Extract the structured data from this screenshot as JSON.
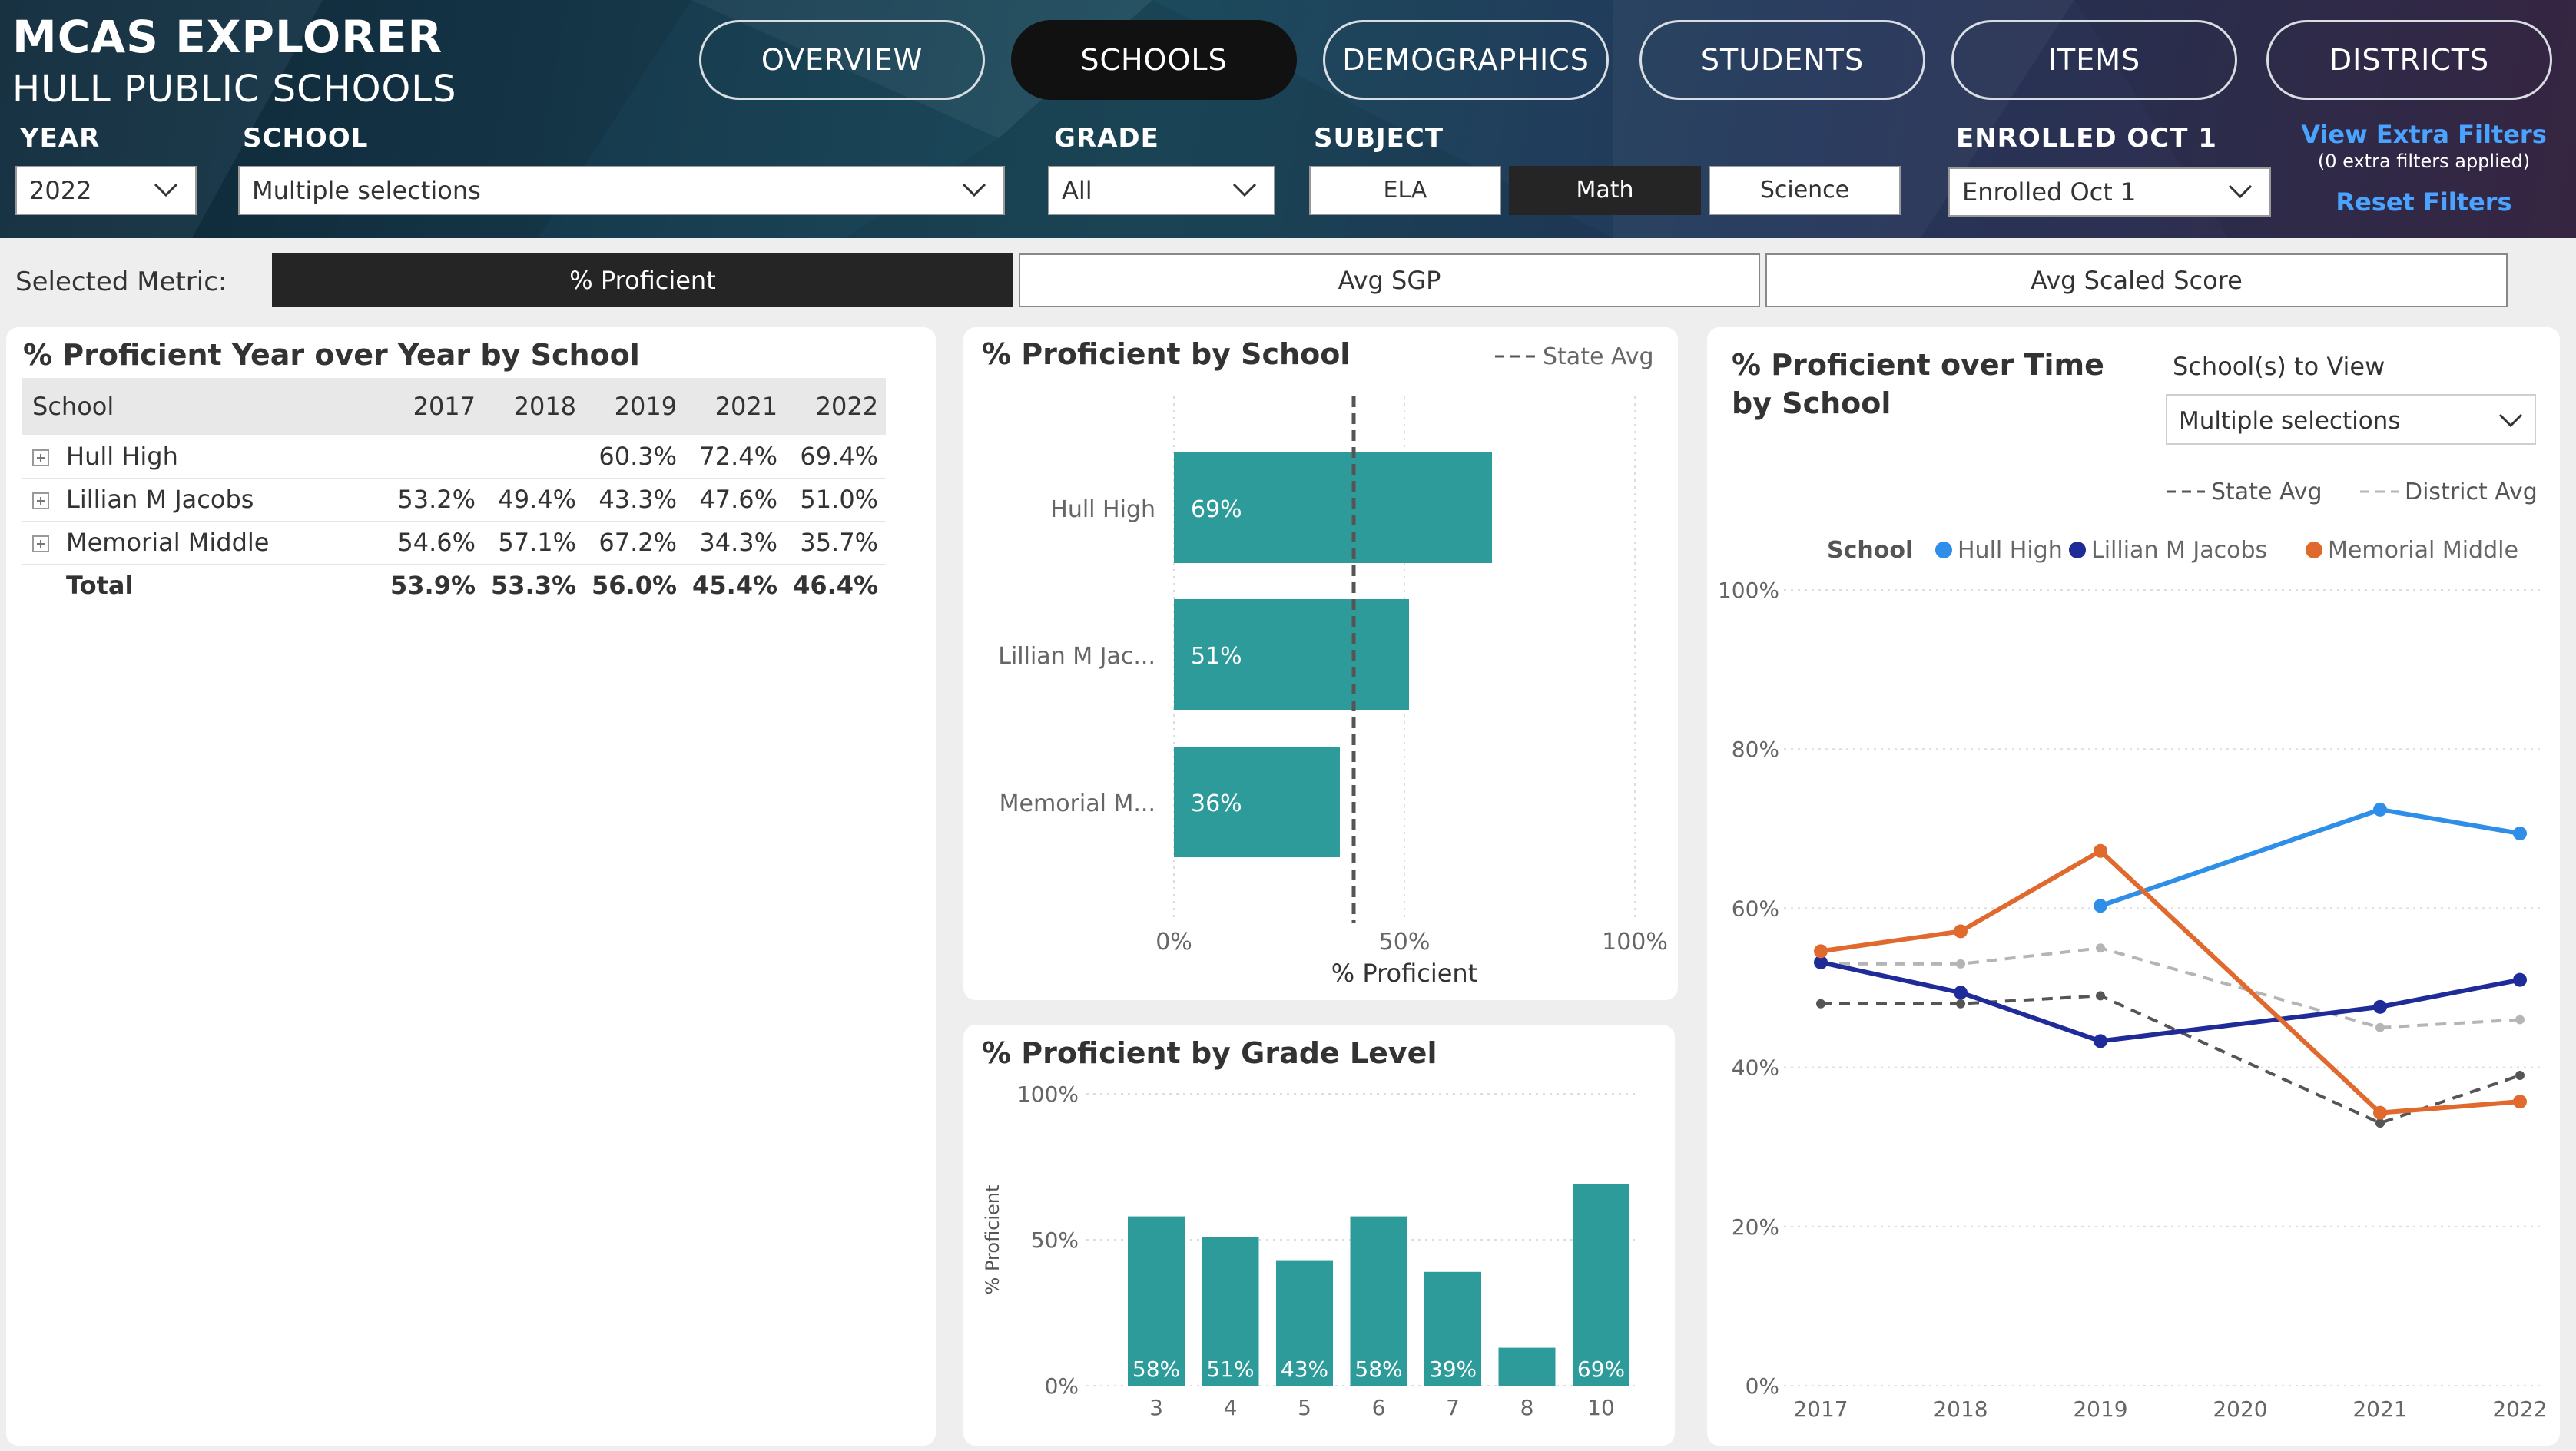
{
  "app": {
    "title": "MCAS EXPLORER",
    "subtitle": "HULL PUBLIC SCHOOLS"
  },
  "nav": [
    {
      "label": "OVERVIEW",
      "active": false
    },
    {
      "label": "SCHOOLS",
      "active": true
    },
    {
      "label": "DEMOGRAPHICS",
      "active": false
    },
    {
      "label": "STUDENTS",
      "active": false
    },
    {
      "label": "ITEMS",
      "active": false
    },
    {
      "label": "DISTRICTS",
      "active": false
    }
  ],
  "filters": {
    "year": {
      "label": "YEAR",
      "value": "2022"
    },
    "school": {
      "label": "SCHOOL",
      "value": "Multiple selections"
    },
    "grade": {
      "label": "GRADE",
      "value": "All"
    },
    "subject": {
      "label": "SUBJECT",
      "options": [
        "ELA",
        "Math",
        "Science"
      ],
      "selected": "Math"
    },
    "enrolled": {
      "label": "ENROLLED OCT 1",
      "value": "Enrolled Oct 1"
    },
    "extra_filters_link": "View Extra Filters",
    "extra_filters_note": "(0 extra filters applied)",
    "reset_link": "Reset Filters"
  },
  "metric": {
    "label": "Selected Metric:",
    "options": [
      "% Proficient",
      "Avg SGP",
      "Avg Scaled Score"
    ],
    "selected": "% Proficient"
  },
  "table": {
    "title": "% Proficient Year over Year by School",
    "columns": [
      "School",
      "2017",
      "2018",
      "2019",
      "2021",
      "2022"
    ],
    "rows": [
      {
        "school": "Hull High",
        "values": [
          "",
          "",
          "60.3%",
          "72.4%",
          "69.4%"
        ]
      },
      {
        "school": "Lillian M Jacobs",
        "values": [
          "53.2%",
          "49.4%",
          "43.3%",
          "47.6%",
          "51.0%"
        ]
      },
      {
        "school": "Memorial Middle",
        "values": [
          "54.6%",
          "57.1%",
          "67.2%",
          "34.3%",
          "35.7%"
        ]
      }
    ],
    "total": {
      "label": "Total",
      "values": [
        "53.9%",
        "53.3%",
        "56.0%",
        "45.4%",
        "46.4%"
      ]
    }
  },
  "colors": {
    "teal": "#2e9b9b",
    "hull_high": "#2f8fe8",
    "lillian": "#1f2b99",
    "memorial": "#e0692d",
    "state_avg": "#555555",
    "district_avg": "#b5b5b5"
  },
  "chart_data": [
    {
      "type": "bar",
      "orientation": "horizontal",
      "title": "% Proficient by School",
      "legend": [
        "State Avg"
      ],
      "categories": [
        "Hull High",
        "Lillian M Jac...",
        "Memorial M..."
      ],
      "values": [
        69,
        51,
        36
      ],
      "data_labels": [
        "69%",
        "51%",
        "36%"
      ],
      "reference_line": {
        "name": "State Avg",
        "value": 39
      },
      "xlabel": "% Proficient",
      "xticks": [
        "0%",
        "50%",
        "100%"
      ],
      "xlim": [
        0,
        100
      ]
    },
    {
      "type": "bar",
      "title": "% Proficient by Grade Level",
      "categories": [
        "3",
        "4",
        "5",
        "6",
        "7",
        "8",
        "10"
      ],
      "values": [
        58,
        51,
        43,
        58,
        39,
        13,
        69
      ],
      "data_labels": [
        "58%",
        "51%",
        "43%",
        "58%",
        "39%",
        "",
        "69%"
      ],
      "ylabel": "% Proficient",
      "yticks": [
        "0%",
        "50%",
        "100%"
      ],
      "ylim": [
        0,
        100
      ]
    },
    {
      "type": "line",
      "title_lines": [
        "% Proficient over Time",
        "by School"
      ],
      "selector": {
        "label": "School(s) to View",
        "value": "Multiple selections"
      },
      "legend_title": "School",
      "x": [
        "2017",
        "2018",
        "2019",
        "2020",
        "2021",
        "2022"
      ],
      "yticks": [
        "0%",
        "20%",
        "40%",
        "60%",
        "80%",
        "100%"
      ],
      "ylim": [
        0,
        100
      ],
      "series": [
        {
          "name": "Hull High",
          "values": [
            null,
            null,
            60.3,
            null,
            72.4,
            69.4
          ]
        },
        {
          "name": "Lillian M Jacobs",
          "values": [
            53.2,
            49.4,
            43.3,
            null,
            47.6,
            51.0
          ]
        },
        {
          "name": "Memorial Middle",
          "values": [
            54.6,
            57.1,
            67.2,
            null,
            34.3,
            35.7
          ]
        }
      ],
      "reference_lines": [
        {
          "name": "State Avg",
          "values": [
            48,
            48,
            49,
            null,
            33,
            39
          ]
        },
        {
          "name": "District Avg",
          "values": [
            53,
            53,
            55,
            null,
            45,
            46
          ]
        }
      ]
    }
  ]
}
